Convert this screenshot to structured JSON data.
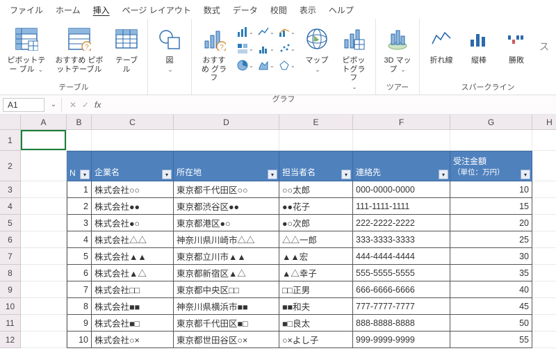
{
  "menu": {
    "items": [
      "ファイル",
      "ホーム",
      "挿入",
      "ページ レイアウト",
      "数式",
      "データ",
      "校閲",
      "表示",
      "ヘルプ"
    ],
    "active": "挿入"
  },
  "ribbon": {
    "groups": {
      "tables": {
        "label": "テーブル",
        "pivot": "ピボットテー\nブル",
        "recommended_pivot": "おすすめ\nピボットテーブル",
        "table": "テーブル"
      },
      "illustrations": {
        "label": "図",
        "item": "図"
      },
      "charts": {
        "label": "グラフ",
        "recommended": "おすすめ\nグラフ",
        "maps": "マップ",
        "pivot_chart": "ピボットグラフ"
      },
      "tours": {
        "label": "ツアー",
        "item": "3D\nマップ"
      },
      "sparklines": {
        "label": "スパークライン",
        "line": "折れ線",
        "column": "縦棒",
        "winloss": "勝敗"
      }
    }
  },
  "namebox": {
    "value": "A1"
  },
  "formula": {
    "value": ""
  },
  "columns": [
    {
      "letter": "A",
      "w": 66
    },
    {
      "letter": "B",
      "w": 36
    },
    {
      "letter": "C",
      "w": 118
    },
    {
      "letter": "D",
      "w": 152
    },
    {
      "letter": "E",
      "w": 106
    },
    {
      "letter": "F",
      "w": 140
    },
    {
      "letter": "G",
      "w": 118
    },
    {
      "letter": "H",
      "w": 50
    }
  ],
  "rows": [
    {
      "n": 1,
      "h": 30
    },
    {
      "n": 2,
      "h": 44
    },
    {
      "n": 3,
      "h": 24
    },
    {
      "n": 4,
      "h": 24
    },
    {
      "n": 5,
      "h": 24
    },
    {
      "n": 6,
      "h": 24
    },
    {
      "n": 7,
      "h": 24
    },
    {
      "n": 8,
      "h": 24
    },
    {
      "n": 9,
      "h": 24
    },
    {
      "n": 10,
      "h": 24
    },
    {
      "n": 11,
      "h": 24
    },
    {
      "n": 12,
      "h": 24
    }
  ],
  "table": {
    "headers": {
      "no": "N",
      "company": "企業名",
      "location": "所在地",
      "contact_name": "担当者名",
      "phone": "連絡先",
      "amount": "受注金額",
      "amount_sub": "（単位：万円）"
    },
    "rows": [
      {
        "no": "1",
        "company": "株式会社○○",
        "location": "東京都千代田区○○",
        "contact": "○○太郎",
        "phone": "000-0000-0000",
        "amount": "10"
      },
      {
        "no": "2",
        "company": "株式会社●●",
        "location": "東京都渋谷区●●",
        "contact": "●●花子",
        "phone": "111-1111-1111",
        "amount": "15"
      },
      {
        "no": "3",
        "company": "株式会社●○",
        "location": "東京都港区●○",
        "contact": "●○次郎",
        "phone": "222-2222-2222",
        "amount": "20"
      },
      {
        "no": "4",
        "company": "株式会社△△",
        "location": "神奈川県川崎市△△",
        "contact": "△△一郎",
        "phone": "333-3333-3333",
        "amount": "25"
      },
      {
        "no": "5",
        "company": "株式会社▲▲",
        "location": "東京都立川市▲▲",
        "contact": "▲▲宏",
        "phone": "444-4444-4444",
        "amount": "30"
      },
      {
        "no": "6",
        "company": "株式会社▲△",
        "location": "東京都新宿区▲△",
        "contact": "▲△幸子",
        "phone": "555-5555-5555",
        "amount": "35"
      },
      {
        "no": "7",
        "company": "株式会社□□",
        "location": "東京都中央区□□",
        "contact": "□□正男",
        "phone": "666-6666-6666",
        "amount": "40"
      },
      {
        "no": "8",
        "company": "株式会社■■",
        "location": "神奈川県横浜市■■",
        "contact": "■■和夫",
        "phone": "777-7777-7777",
        "amount": "45"
      },
      {
        "no": "9",
        "company": "株式会社■□",
        "location": "東京都千代田区■□",
        "contact": "■□良太",
        "phone": "888-8888-8888",
        "amount": "50"
      },
      {
        "no": "10",
        "company": "株式会社○×",
        "location": "東京都世田谷区○×",
        "contact": "○×よし子",
        "phone": "999-9999-9999",
        "amount": "55"
      }
    ]
  }
}
